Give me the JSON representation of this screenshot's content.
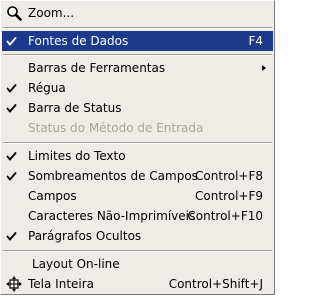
{
  "menu": {
    "items": [
      {
        "label": "Zoom...",
        "icon": "magnifier-icon",
        "mnemonic": "Z"
      },
      {
        "label": "Fontes de Dados",
        "shortcut": "F4",
        "checked": true,
        "highlighted": true
      },
      {
        "label": "Barras de Ferramentas",
        "submenu": true
      },
      {
        "label": "Régua",
        "checked": true
      },
      {
        "label": "Barra de Status",
        "checked": true
      },
      {
        "label": "Status do Método de Entrada",
        "disabled": true
      },
      {
        "label": "Limites do Texto",
        "checked": true
      },
      {
        "label": "Sombreamentos de Campos",
        "shortcut": "Control+F8",
        "checked": true
      },
      {
        "label": "Campos",
        "shortcut": "Control+F9"
      },
      {
        "label": "Caracteres Não-Imprimíveis",
        "shortcut": "Control+F10"
      },
      {
        "label": "Parágrafos Ocultos",
        "checked": true
      },
      {
        "label": "Layout On-line"
      },
      {
        "label": "Tela Inteira",
        "shortcut": "Control+Shift+J",
        "icon": "fullscreen-icon"
      }
    ]
  },
  "colors": {
    "menu_background": "#efebe7",
    "highlight": "#1b3a8c",
    "disabled_text": "#a8a49e"
  }
}
